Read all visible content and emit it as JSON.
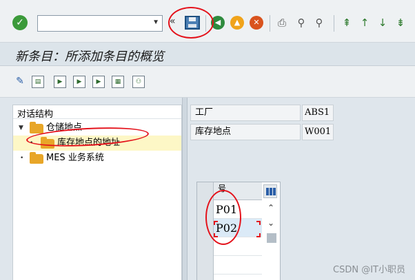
{
  "toolbar": {
    "command_field_value": "",
    "icons": [
      "check-icon",
      "save-icon",
      "back-icon",
      "exit-icon",
      "cancel-icon",
      "print-icon",
      "find-icon",
      "find-next-icon",
      "first-page-icon",
      "prev-page-icon",
      "next-page-icon",
      "last-page-icon"
    ],
    "nav_arrows": "«"
  },
  "page": {
    "title": "新条目：所添加条目的概览"
  },
  "app_toolbar": {
    "icons": [
      "display-change-icon",
      "new-entries-icon",
      "copy-as-icon",
      "delete-icon",
      "undo-change-icon",
      "select-all-icon",
      "deselect-all-icon",
      "print-field-icon"
    ]
  },
  "tree": {
    "header": "对话结构",
    "nodes": [
      {
        "label": "仓储地点",
        "level": 0,
        "expanded": true
      },
      {
        "label": "库存地点的地址",
        "level": 1,
        "selected": true
      },
      {
        "label": "MES 业务系统",
        "level": 0,
        "expanded": false
      }
    ]
  },
  "header_fields": [
    {
      "label": "工厂",
      "value": "ABS1"
    },
    {
      "label": "库存地点",
      "value": "W001"
    }
  ],
  "table": {
    "column_header": "号",
    "rows": [
      "P01",
      "P02",
      "",
      "",
      ""
    ]
  },
  "watermark": "CSDN @IT小职员",
  "colors": {
    "annotation_red": "#e4121b",
    "selected_row": "#fdf7c6",
    "active_cell": "#dbeaf7",
    "folder": "#e8a628"
  }
}
